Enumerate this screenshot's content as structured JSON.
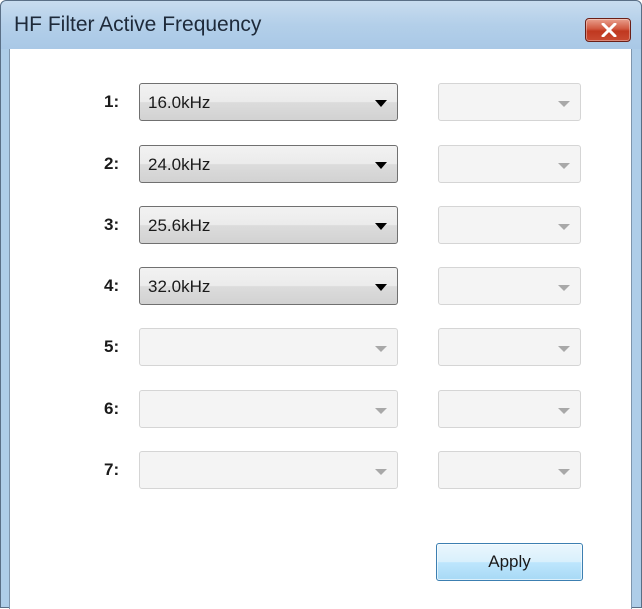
{
  "window": {
    "title": "HF Filter Active Frequency",
    "close_glyph": "✕"
  },
  "rows": [
    {
      "label": "1:",
      "primary_value": "16.0kHz",
      "primary_enabled": true,
      "secondary_value": "",
      "secondary_enabled": false
    },
    {
      "label": "2:",
      "primary_value": "24.0kHz",
      "primary_enabled": true,
      "secondary_value": "",
      "secondary_enabled": false
    },
    {
      "label": "3:",
      "primary_value": "25.6kHz",
      "primary_enabled": true,
      "secondary_value": "",
      "secondary_enabled": false
    },
    {
      "label": "4:",
      "primary_value": "32.0kHz",
      "primary_enabled": true,
      "secondary_value": "",
      "secondary_enabled": false
    },
    {
      "label": "5:",
      "primary_value": "",
      "primary_enabled": false,
      "secondary_value": "",
      "secondary_enabled": false
    },
    {
      "label": "6:",
      "primary_value": "",
      "primary_enabled": false,
      "secondary_value": "",
      "secondary_enabled": false
    },
    {
      "label": "7:",
      "primary_value": "",
      "primary_enabled": false,
      "secondary_value": "",
      "secondary_enabled": false
    }
  ],
  "buttons": {
    "apply_label": "Apply"
  },
  "colors": {
    "titlebar": "#b3cfe9",
    "close_button": "#c94a32",
    "apply_button": "#bee6fd"
  }
}
